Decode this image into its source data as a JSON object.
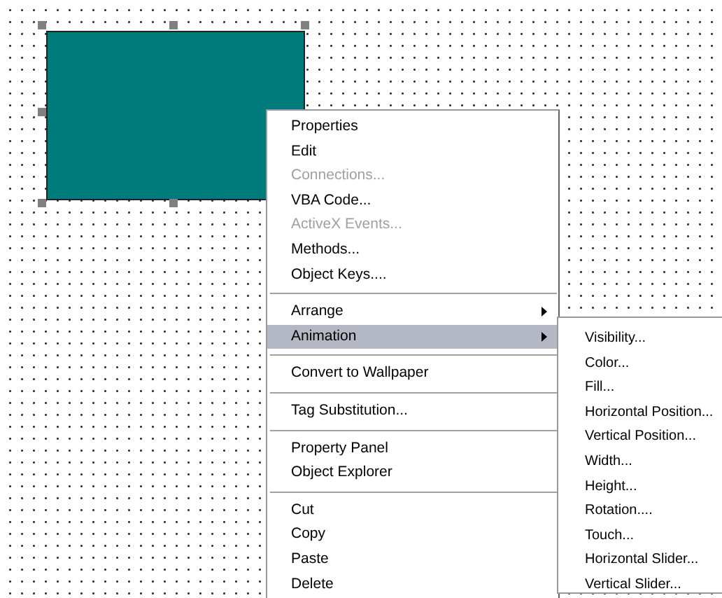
{
  "canvas": {
    "shape": {
      "kind": "rectangle",
      "color": "#007b7b",
      "selected": true
    }
  },
  "context_menu": {
    "groups": [
      {
        "items": [
          {
            "label": "Properties",
            "disabled": false,
            "submenu": false,
            "selected": false
          },
          {
            "label": "Edit",
            "disabled": false,
            "submenu": false,
            "selected": false
          },
          {
            "label": "Connections...",
            "disabled": true,
            "submenu": false,
            "selected": false
          },
          {
            "label": "VBA Code...",
            "disabled": false,
            "submenu": false,
            "selected": false
          },
          {
            "label": "ActiveX Events...",
            "disabled": true,
            "submenu": false,
            "selected": false
          },
          {
            "label": "Methods...",
            "disabled": false,
            "submenu": false,
            "selected": false
          },
          {
            "label": "Object Keys....",
            "disabled": false,
            "submenu": false,
            "selected": false
          }
        ]
      },
      {
        "items": [
          {
            "label": "Arrange",
            "disabled": false,
            "submenu": true,
            "selected": false
          },
          {
            "label": "Animation",
            "disabled": false,
            "submenu": true,
            "selected": true
          }
        ]
      },
      {
        "items": [
          {
            "label": "Convert to Wallpaper",
            "disabled": false,
            "submenu": false,
            "selected": false
          }
        ]
      },
      {
        "items": [
          {
            "label": "Tag Substitution...",
            "disabled": false,
            "submenu": false,
            "selected": false
          }
        ]
      },
      {
        "items": [
          {
            "label": "Property Panel",
            "disabled": false,
            "submenu": false,
            "selected": false
          },
          {
            "label": "Object Explorer",
            "disabled": false,
            "submenu": false,
            "selected": false
          }
        ]
      },
      {
        "items": [
          {
            "label": "Cut",
            "disabled": false,
            "submenu": false,
            "selected": false
          },
          {
            "label": "Copy",
            "disabled": false,
            "submenu": false,
            "selected": false
          },
          {
            "label": "Paste",
            "disabled": false,
            "submenu": false,
            "selected": false
          },
          {
            "label": "Delete",
            "disabled": false,
            "submenu": false,
            "selected": false
          }
        ]
      }
    ]
  },
  "submenu": {
    "items": [
      "Visibility...",
      "Color...",
      "Fill...",
      "Horizontal Position...",
      "Vertical Position...",
      "Width...",
      "Height...",
      "Rotation....",
      "Touch...",
      "Horizontal Slider...",
      "Vertical Slider..."
    ]
  }
}
